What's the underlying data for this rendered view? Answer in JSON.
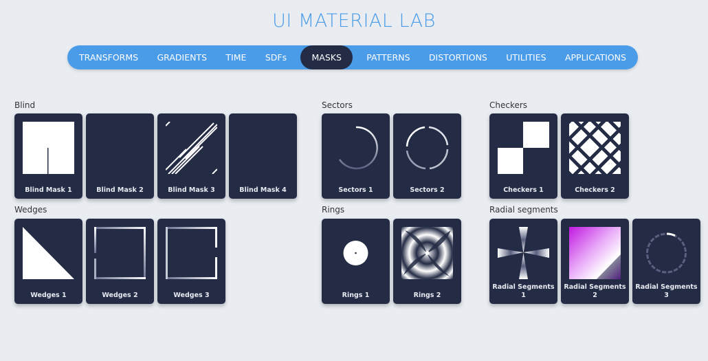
{
  "app": {
    "title": "UI MATERIAL LAB"
  },
  "nav": {
    "items": [
      {
        "label": "TRANSFORMS"
      },
      {
        "label": "GRADIENTS"
      },
      {
        "label": "TIME"
      },
      {
        "label": "SDFs"
      },
      {
        "label": "MASKS",
        "active": true
      },
      {
        "label": "PATTERNS"
      },
      {
        "label": "DISTORTIONS"
      },
      {
        "label": "UTILITIES"
      },
      {
        "label": "APPLICATIONS"
      }
    ]
  },
  "groups": {
    "blind": {
      "label": "Blind",
      "cards": [
        "Blind Mask 1",
        "Blind Mask 2",
        "Blind Mask 3",
        "Blind Mask 4"
      ]
    },
    "sectors": {
      "label": "Sectors",
      "cards": [
        "Sectors 1",
        "Sectors 2"
      ]
    },
    "checkers": {
      "label": "Checkers",
      "cards": [
        "Checkers 1",
        "Checkers 2"
      ]
    },
    "wedges": {
      "label": "Wedges",
      "cards": [
        "Wedges 1",
        "Wedges 2",
        "Wedges 3"
      ]
    },
    "rings": {
      "label": "Rings",
      "cards": [
        "Rings 1",
        "Rings 2"
      ]
    },
    "radial": {
      "label": "Radial segments",
      "cards": [
        "Radial Segments 1",
        "Radial Segments 2",
        "Radial Segments 3"
      ]
    }
  },
  "colors": {
    "accent": "#4a9be8",
    "card_bg": "#242c45",
    "page_bg": "#e9edf2"
  }
}
